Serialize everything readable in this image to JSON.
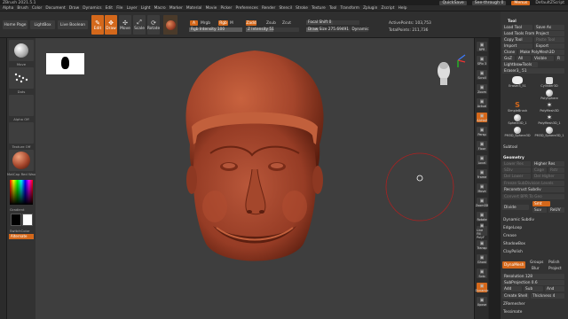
{
  "titlebar": {
    "title": "ZBrush 2021.5.1",
    "quicksave": "QuickSave",
    "seethrough": "See-through 0",
    "menus": "Menus",
    "script": "DefaultZScript"
  },
  "menu": [
    "Alpha",
    "Brush",
    "Color",
    "Document",
    "Draw",
    "Dynamics",
    "Edit",
    "File",
    "Layer",
    "Light",
    "Macro",
    "Marker",
    "Material",
    "Movie",
    "Picker",
    "Preferences",
    "Render",
    "Stencil",
    "Stroke",
    "Texture",
    "Tool",
    "Transform",
    "Zplugin",
    "Zscript",
    "Help"
  ],
  "toolbar": {
    "home": "Home Page",
    "lightbox": "LightBox",
    "liveboolean": "Live Boolean",
    "edit": "Edit",
    "draw": "Draw",
    "move": "Move",
    "scale": "Scale",
    "rotate": "Rotate",
    "a": "A",
    "mrgb": "Mrgb",
    "rgb": "Rgb",
    "m": "M",
    "zadd": "Zadd",
    "zsub": "Zsub",
    "zcut": "Zcut",
    "rgb_intensity": "Rgb Intensity 100",
    "z_intensity": "Z Intensity 51",
    "focal_shift": "Focal Shift 0",
    "draw_size": "Draw Size 275.69491",
    "dynamic": "Dynamic",
    "active_points": "ActivePoints: 103,753",
    "total_points": "TotalPoints: 211,736"
  },
  "left": {
    "brush": "Move",
    "stroke": "Dots",
    "alpha": "Alpha Off",
    "texture": "Texture Off",
    "material": "MatCap Red Wax",
    "gradient": "Gradient",
    "switch": "SwitchColor",
    "alternate": "Alternate"
  },
  "rightshelf": [
    "BPR",
    "SPix 3",
    "Scroll",
    "Zoom",
    "Actual",
    "AAHalf",
    "Persp",
    "Floor",
    "Local",
    "Frame",
    "Move",
    "Zoom3D",
    "Rotate",
    "Line Fill PolyF",
    "Transp",
    "Ghost",
    "Solo",
    "Dynamic",
    "Xpose"
  ],
  "tool": {
    "header": "Tool",
    "load_tool": "Load Tool",
    "save_as": "Save As",
    "load_project": "Load Tools From Project",
    "copy_tool": "Copy Tool",
    "paste_tool": "Paste Tool",
    "import": "Import",
    "export": "Export",
    "clone": "Clone",
    "make_polymesh": "Make PolyMesh3D",
    "goz": "GoZ",
    "all": "All",
    "visible": "Visible",
    "r": "R",
    "lightbox_tools": "Lightbox▸Tools",
    "current": "Eraser3_ 51",
    "thumbs": [
      "Eraser3_51",
      "Cylinder3D",
      "PolySphere",
      "SimpleBrush",
      "PolyMesh3D",
      "Sphere3D_1",
      "PolyMesh3D_1",
      "PM3D_Sphere3D",
      "PM3D_Sphere3D_1"
    ],
    "subtool": "Subtool",
    "geometry": "Geometry",
    "lower_res": "Lower Res",
    "higher_res": "Higher Res",
    "sdiv": "SDiv",
    "cage": "Cage",
    "rstr": "Rstr",
    "del_lower": "Del Lower",
    "del_higher": "Del Higher",
    "freeze": "Freeze SubDivision Levels",
    "reconstruct": "Reconstruct Subdiv",
    "convert": "Convert BPR To Geo",
    "divide": "Divide",
    "smt": "Smt",
    "suv": "Suv",
    "reuv": "ReUV",
    "dynamic_subdiv": "Dynamic Subdiv",
    "edgeloop": "EdgeLoop",
    "crease": "Crease",
    "shadowbox": "ShadowBox",
    "claypolish": "ClayPolish",
    "dynamesh": "DynaMesh",
    "groups": "Groups",
    "polish": "Polish",
    "blur": "Blur",
    "project": "Project",
    "resolution": "Resolution 128",
    "subprojection": "SubProjection 0.6",
    "add": "Add",
    "sub": "Sub",
    "and": "And",
    "create_shell": "Create Shell",
    "thickness": "Thickness 4",
    "zremesher": "ZRemesher",
    "tessimate": "Tessimate"
  },
  "colors": {
    "accent": "#d4681b",
    "wax": "#a4452b"
  }
}
